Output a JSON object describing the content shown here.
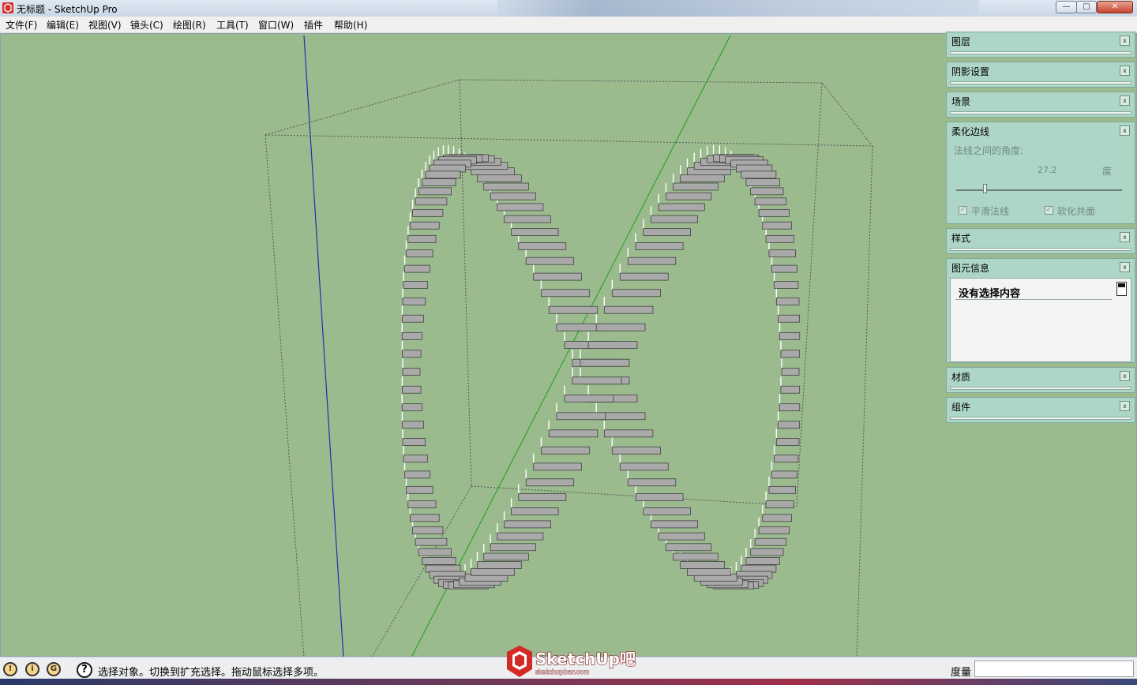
{
  "window": {
    "title": "无标题 - SketchUp Pro",
    "buttons": {
      "minimize": "—",
      "maximize": "□",
      "close": "✕"
    }
  },
  "menu": [
    "文件(F)",
    "编辑(E)",
    "视图(V)",
    "镜头(C)",
    "绘图(R)",
    "工具(T)",
    "窗口(W)",
    "插件",
    "帮助(H)"
  ],
  "tray": {
    "panels": {
      "layers": "图层",
      "shadows": "阴影设置",
      "scenes": "场景",
      "soften": "柔化边线",
      "styles": "样式",
      "entity": "图元信息",
      "materials": "材质",
      "components": "组件"
    },
    "soften_edges": {
      "angle_label": "法线之间的角度:",
      "angle_value": "27.2",
      "angle_unit": "度",
      "slider_fraction": 0.16,
      "smooth_normals_label": "平滑法线",
      "smooth_normals_checked": true,
      "soften_coplanar_label": "软化共面",
      "soften_coplanar_checked": true
    },
    "entity_info": {
      "text": "没有选择内容"
    },
    "close_glyph": "x"
  },
  "status": {
    "text": "选择对象。切换到扩充选择。拖动鼠标选择多项。",
    "help": "?",
    "measure_label": "度量",
    "measure_value": ""
  },
  "logo": {
    "text": "SketchUp吧",
    "url_text": "sketchupbar.com"
  },
  "colors": {
    "viewport": "#9bbb8f",
    "tray": "#aed6c6",
    "stair_tread": "#a9a9a9"
  }
}
